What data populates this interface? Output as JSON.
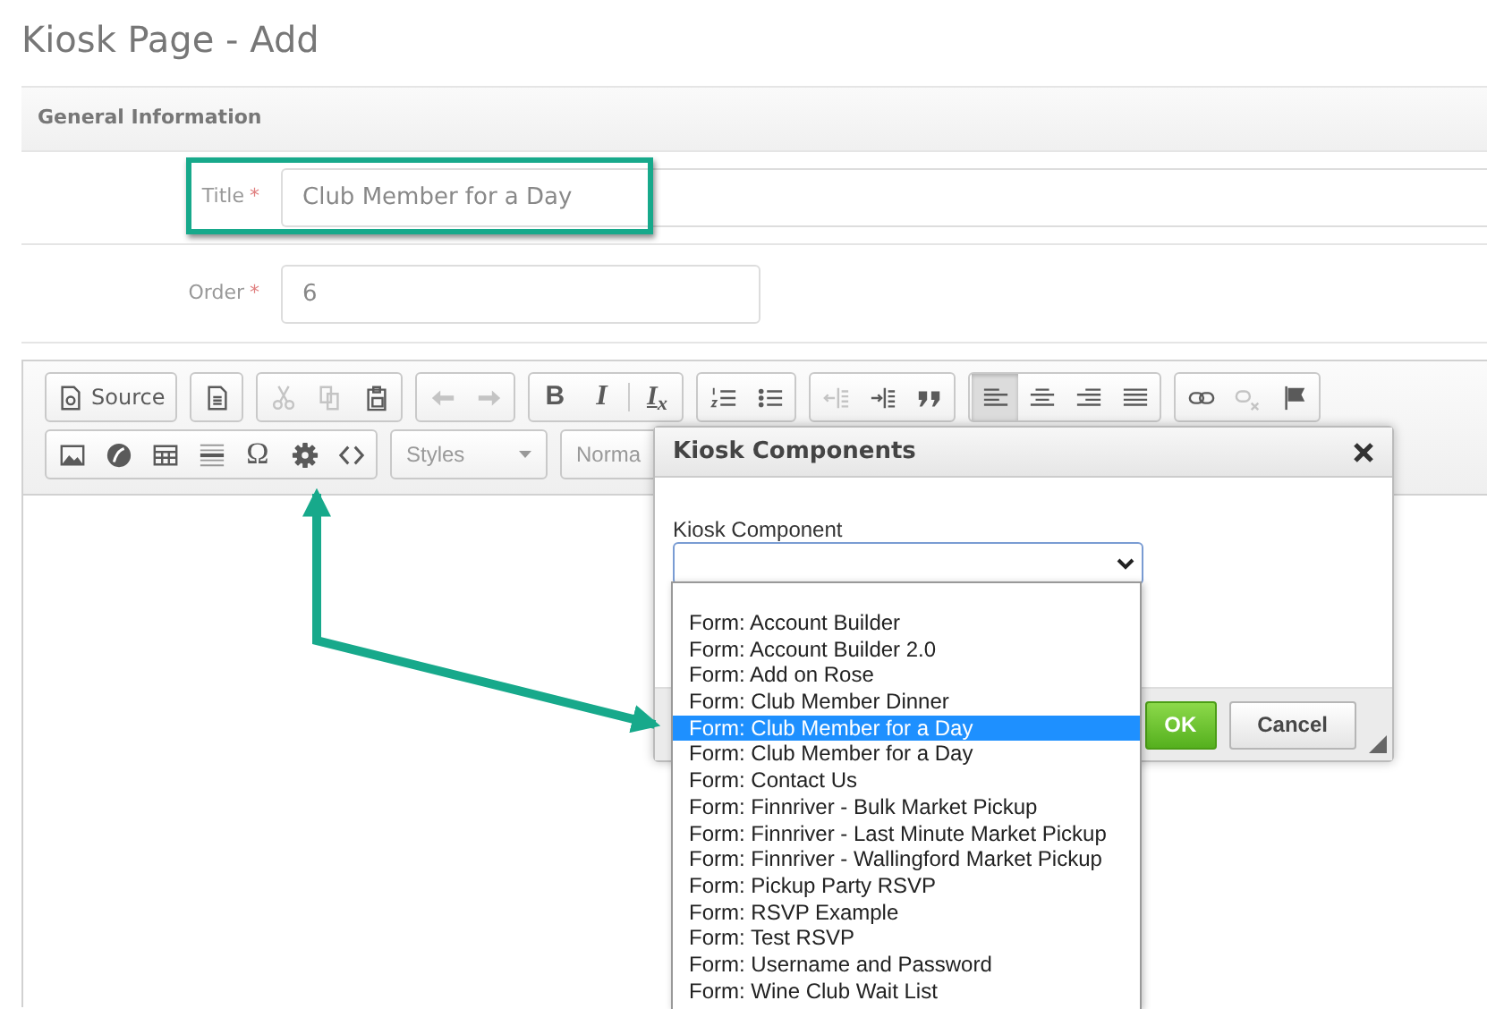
{
  "page_title": "Kiosk Page - Add",
  "section": {
    "title": "General Information"
  },
  "fields": [
    {
      "label": "Title",
      "required_mark": "*",
      "value": "Club Member for a Day",
      "highlighted": true
    },
    {
      "label": "Order",
      "required_mark": "*",
      "value": "6",
      "highlighted": false
    }
  ],
  "editor": {
    "toolbar": [
      [
        {
          "buttons": [
            {
              "kind": "source",
              "label": "Source",
              "disabled": false,
              "on": false
            }
          ]
        },
        {
          "buttons": [
            {
              "kind": "document",
              "disabled": false,
              "on": false
            }
          ]
        },
        {
          "buttons": [
            {
              "kind": "cut",
              "disabled": true,
              "on": false
            },
            {
              "kind": "copy",
              "disabled": true,
              "on": false
            },
            {
              "kind": "paste",
              "disabled": false,
              "on": false
            }
          ]
        },
        {
          "buttons": [
            {
              "kind": "undo",
              "disabled": true,
              "on": false
            },
            {
              "kind": "redo",
              "disabled": true,
              "on": false
            }
          ]
        },
        {
          "buttons": [
            {
              "kind": "bold",
              "label": "B",
              "disabled": false,
              "on": false
            },
            {
              "kind": "italic",
              "label": "I",
              "disabled": false,
              "on": false
            },
            {
              "kind": "separator"
            },
            {
              "kind": "removeformat",
              "label": "I$_{x}$",
              "disabled": false,
              "on": false
            }
          ]
        },
        {
          "buttons": [
            {
              "kind": "numbered",
              "disabled": false,
              "on": false
            },
            {
              "kind": "bulleted",
              "disabled": false,
              "on": false
            }
          ]
        },
        {
          "buttons": [
            {
              "kind": "outdent",
              "disabled": true,
              "on": false
            },
            {
              "kind": "indent",
              "disabled": false,
              "on": false
            },
            {
              "kind": "quote",
              "disabled": false,
              "on": false
            }
          ]
        },
        {
          "buttons": [
            {
              "kind": "align-left",
              "disabled": false,
              "on": true
            },
            {
              "kind": "align-center",
              "disabled": false,
              "on": false
            },
            {
              "kind": "align-right",
              "disabled": false,
              "on": false
            },
            {
              "kind": "justify",
              "disabled": false,
              "on": false
            }
          ]
        },
        {
          "buttons": [
            {
              "kind": "link",
              "disabled": false,
              "on": false
            },
            {
              "kind": "unlink",
              "disabled": true,
              "on": false
            },
            {
              "kind": "flag",
              "disabled": false,
              "on": false
            }
          ]
        }
      ],
      [
        {
          "buttons": [
            {
              "kind": "image",
              "disabled": false,
              "on": false
            },
            {
              "kind": "disc",
              "disabled": false,
              "on": false
            },
            {
              "kind": "table",
              "disabled": false,
              "on": false
            },
            {
              "kind": "rule",
              "disabled": false,
              "on": false
            },
            {
              "kind": "special",
              "label": "Ω",
              "disabled": false,
              "on": false
            },
            {
              "kind": "gear",
              "disabled": false,
              "on": false
            },
            {
              "kind": "code",
              "disabled": false,
              "on": false
            }
          ]
        },
        {
          "combo": "Styles"
        },
        {
          "combo": "Norma"
        }
      ]
    ]
  },
  "dialog": {
    "title": "Kiosk Components",
    "field_label": "Kiosk Component",
    "options": [
      {
        "label": "Form: Account Builder",
        "selected": false
      },
      {
        "label": "Form: Account Builder 2.0",
        "selected": false
      },
      {
        "label": "Form: Add on Rose",
        "selected": false
      },
      {
        "label": "Form: Club Member Dinner",
        "selected": false
      },
      {
        "label": "Form: Club Member for a Day",
        "selected": true
      },
      {
        "label": "Form: Club Member for a Day",
        "selected": false
      },
      {
        "label": "Form: Contact Us",
        "selected": false
      },
      {
        "label": "Form: Finnriver - Bulk Market Pickup",
        "selected": false
      },
      {
        "label": "Form: Finnriver - Last Minute Market Pickup",
        "selected": false
      },
      {
        "label": "Form: Finnriver - Wallingford Market Pickup",
        "selected": false
      },
      {
        "label": "Form: Pickup Party RSVP",
        "selected": false
      },
      {
        "label": "Form: RSVP Example",
        "selected": false
      },
      {
        "label": "Form: Test RSVP",
        "selected": false
      },
      {
        "label": "Form: Username and Password",
        "selected": false
      },
      {
        "label": "Form: Wine Club Wait List",
        "selected": false
      }
    ],
    "buttons": [
      {
        "label": "OK",
        "kind": "primary"
      },
      {
        "label": "Cancel",
        "kind": "default"
      }
    ]
  }
}
